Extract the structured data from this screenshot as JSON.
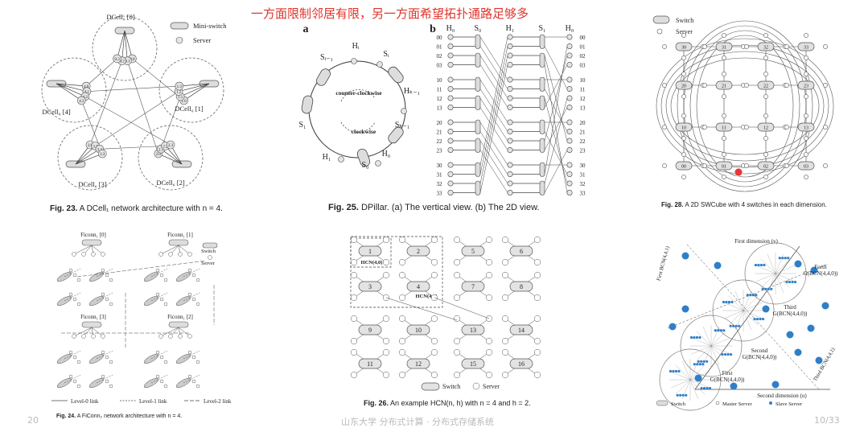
{
  "banner": "一方面限制邻居有限，另一方面希望拓扑通路足够多",
  "footer": {
    "left": "20",
    "center": "山东大学 分布式计算 · 分布式存储系统",
    "right": "10/33"
  },
  "dcell": {
    "caption_num": "Fig. 23.",
    "caption_text": "A DCell₁ network architecture with n = 4.",
    "legend_switch": "Mini-switch",
    "legend_server": "Server",
    "cells": [
      {
        "label": "DCell₀ [0]",
        "servers": [
          "0.0",
          "0.1",
          "0.2",
          "0.3"
        ]
      },
      {
        "label": "DCell₀ [1]",
        "servers": [
          "1.0",
          "1.1",
          "1.2",
          "1.3"
        ]
      },
      {
        "label": "DCell₀ [2]",
        "servers": [
          "2.0",
          "2.1",
          "2.2",
          "2.3"
        ]
      },
      {
        "label": "DCell₀ [3]",
        "servers": [
          "3.0",
          "3.1",
          "3.2",
          "3.3"
        ]
      },
      {
        "label": "DCell₀ [4]",
        "servers": [
          "4.0",
          "4.1",
          "4.2",
          "4.3"
        ]
      }
    ]
  },
  "dpillar": {
    "caption_num": "Fig. 25.",
    "caption_text": "DPillar. (a) The vertical view. (b) The 2D view.",
    "label_a": "a",
    "label_b": "b",
    "ring_labels": [
      "H₀",
      "S₀",
      "H₁",
      "S₁",
      "S_{k-1}",
      "H_{k-1}",
      "Sᵢ",
      "Hᵢ",
      "S_{i-1}"
    ],
    "ring_labels_display": [
      "H₀",
      "S₀",
      "H₁",
      "S₁",
      "Sₖ₋₁",
      "Hₖ₋₁",
      "Sᵢ",
      "Hᵢ",
      "Sᵢ₋₁"
    ],
    "counter_clockwise": "counter-clockwise",
    "clockwise": "clockwise",
    "columns": [
      "H₀",
      "S₀",
      "H₁",
      "S₁",
      "H₀"
    ],
    "rows": [
      "00",
      "01",
      "02",
      "03",
      "10",
      "11",
      "12",
      "13",
      "20",
      "21",
      "22",
      "23",
      "30",
      "31",
      "32",
      "33"
    ]
  },
  "swcube": {
    "caption_num": "Fig. 28.",
    "caption_text": "A 2D SWCube with 4 switches in each dimension.",
    "legend_switch": "Switch",
    "legend_server": "Server",
    "switches": [
      "30",
      "31",
      "32",
      "33",
      "20",
      "21",
      "22",
      "23",
      "10",
      "11",
      "12",
      "13",
      "00",
      "01",
      "02",
      "03"
    ],
    "highlight_color": "#e53935"
  },
  "ficonn": {
    "caption_num": "Fig. 24.",
    "caption_text": "A FiConn₂ network architecture with n = 4.",
    "groups": [
      "Ficonn₁ [0]",
      "Ficonn₁ [1]",
      "Ficonn₁ [3]",
      "Ficonn₁ [2]"
    ],
    "legend_switch": "Switch",
    "legend_server": "Server",
    "links": [
      "Level-0 link",
      "Level-1 link",
      "Level-2 link"
    ]
  },
  "hcn": {
    "caption_num": "Fig. 26.",
    "caption_text": "An example HCN(n, h) with n = 4 and h = 2.",
    "switches": [
      "1",
      "2",
      "5",
      "6",
      "3",
      "4",
      "7",
      "8",
      "9",
      "10",
      "13",
      "14",
      "11",
      "12",
      "15",
      "16"
    ],
    "box1": "HCN(4,0)",
    "box2": "HCN(4,1)",
    "legend_switch": "Switch",
    "legend_server": "Server"
  },
  "bcn": {
    "first_dim": "First dimension (v)",
    "second_dim": "Second dimension (u)",
    "first": "First BCN(4,4,1)",
    "third": "Third BCN(4,4,1)",
    "g_labels": [
      "Forth G(BCN(4,4,0))",
      "Third G(BCN(4,4,0))",
      "Second G(BCN(4,4,0))",
      "First G(BCN(4,4,0))"
    ],
    "legend": [
      "Switch",
      "Master Server",
      "Slave Server"
    ],
    "slave_color": "#2f7fc7"
  }
}
